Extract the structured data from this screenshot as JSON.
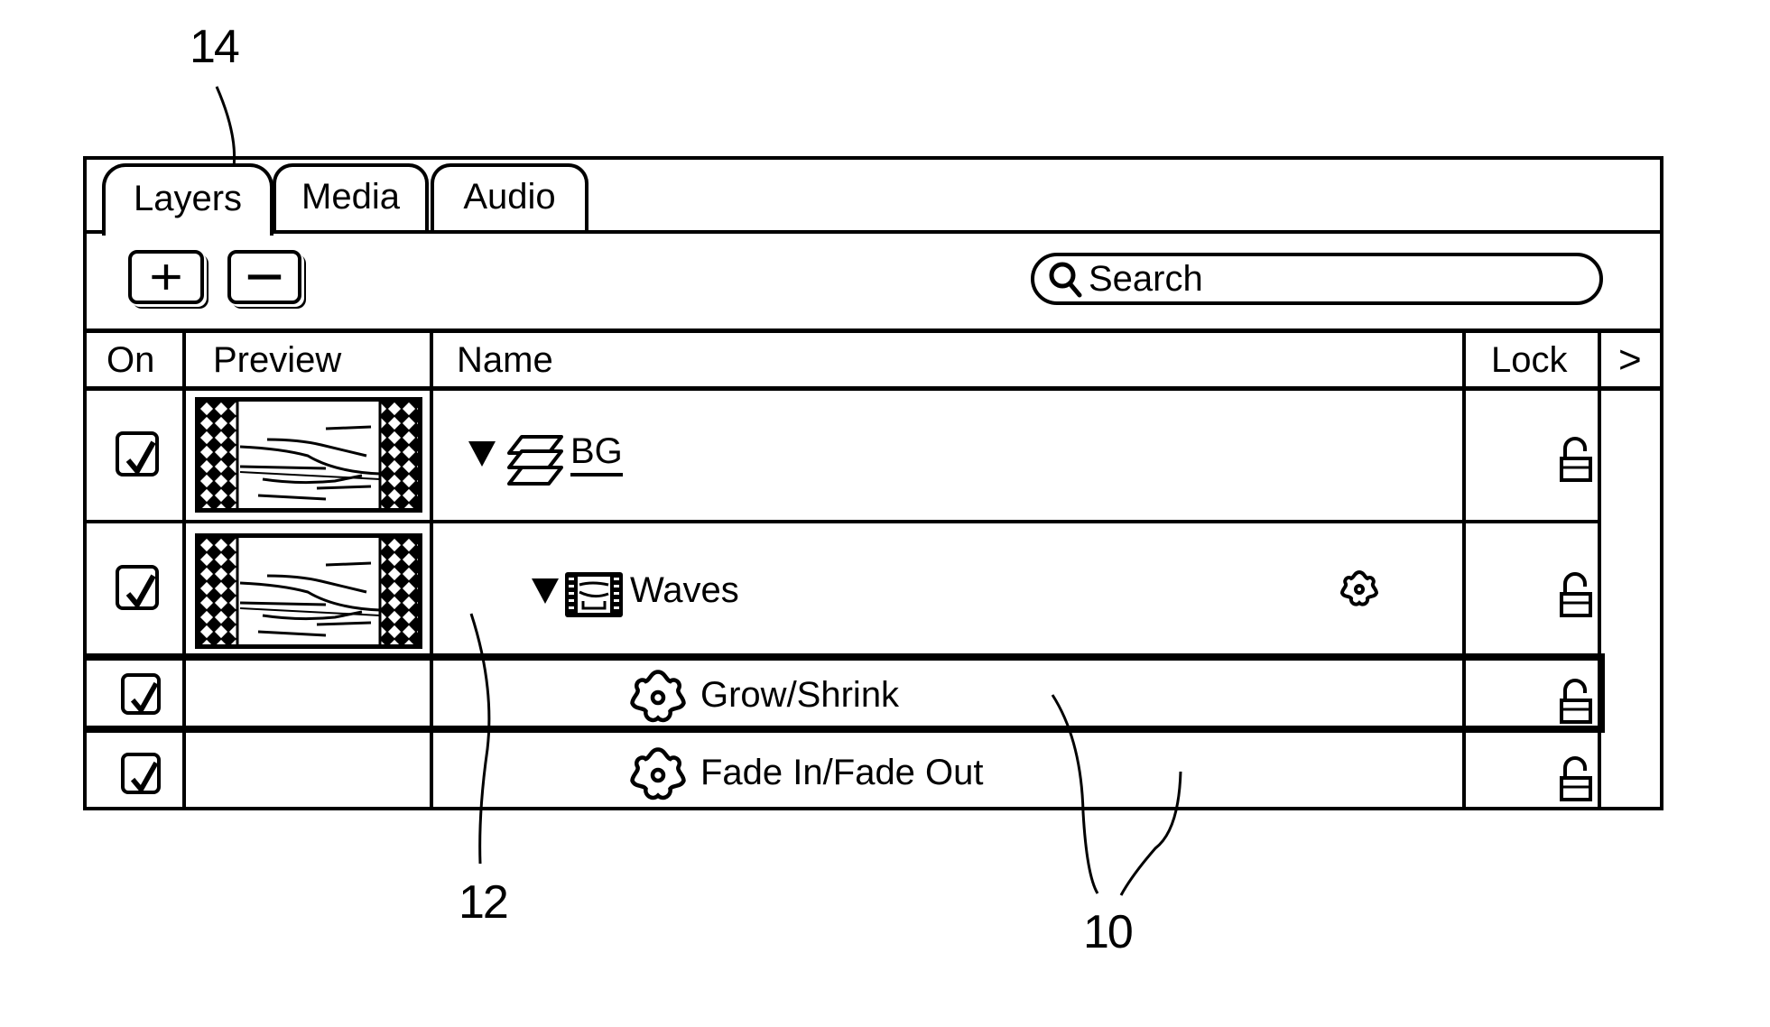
{
  "callouts": {
    "tabs_ref": "14",
    "layer_ref": "12",
    "behavior_ref": "10"
  },
  "tabs": [
    {
      "label": "Layers",
      "active": true
    },
    {
      "label": "Media",
      "active": false
    },
    {
      "label": "Audio",
      "active": false
    }
  ],
  "toolbar": {
    "add_icon": "plus-icon",
    "remove_icon": "minus-icon",
    "search": {
      "placeholder": "Search",
      "value": "",
      "icon": "magnifier-icon"
    }
  },
  "table": {
    "columns": [
      "On",
      "Preview",
      "Name",
      "Lock",
      ">"
    ],
    "rows": [
      {
        "on": true,
        "has_preview": true,
        "expanded": true,
        "icon": "group-layers-icon",
        "name": "BG",
        "underlined": true,
        "has_behavior_badge": false,
        "locked": false,
        "selected": false
      },
      {
        "on": true,
        "has_preview": true,
        "expanded": true,
        "icon": "filmstrip-icon",
        "name": "Waves",
        "underlined": false,
        "has_behavior_badge": true,
        "locked": false,
        "selected": false
      },
      {
        "on": true,
        "has_preview": false,
        "expanded": false,
        "icon": "behavior-gear-icon",
        "name": "Grow/Shrink",
        "underlined": false,
        "has_behavior_badge": false,
        "locked": false,
        "selected": true
      },
      {
        "on": true,
        "has_preview": false,
        "expanded": false,
        "icon": "behavior-gear-icon",
        "name": "Fade In/Fade Out",
        "underlined": false,
        "has_behavior_badge": false,
        "locked": false,
        "selected": false
      }
    ]
  }
}
